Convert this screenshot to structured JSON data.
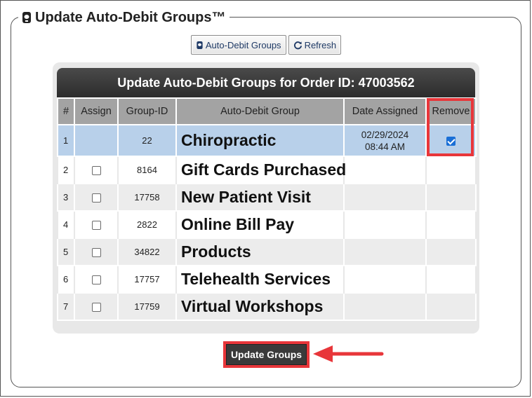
{
  "legend": {
    "title": "Update Auto-Debit Groups™",
    "icon": "piggy-bank-icon"
  },
  "toolbar": {
    "groups_button": "Auto-Debit Groups",
    "refresh_button": "Refresh"
  },
  "table": {
    "title": "Update Auto-Debit Groups for Order ID: 47003562",
    "headers": {
      "num": "#",
      "assign": "Assign",
      "group_id": "Group-ID",
      "group": "Auto-Debit Group",
      "date": "Date Assigned",
      "remove": "Remove"
    },
    "rows": [
      {
        "num": "1",
        "group_id": "22",
        "group": "Chiropractic",
        "date": "02/29/2024",
        "time": "08:44 AM",
        "assigned": true,
        "remove_checked": true
      },
      {
        "num": "2",
        "group_id": "8164",
        "group": "Gift Cards Purchased",
        "assigned": false
      },
      {
        "num": "3",
        "group_id": "17758",
        "group": "New Patient Visit",
        "assigned": false
      },
      {
        "num": "4",
        "group_id": "2822",
        "group": "Online Bill Pay",
        "assigned": false
      },
      {
        "num": "5",
        "group_id": "34822",
        "group": "Products",
        "assigned": false
      },
      {
        "num": "6",
        "group_id": "17757",
        "group": "Telehealth Services",
        "assigned": false
      },
      {
        "num": "7",
        "group_id": "17759",
        "group": "Virtual Workshops",
        "assigned": false
      }
    ]
  },
  "update_button": "Update Groups",
  "colors": {
    "highlight": "#e8363a",
    "selected_row": "#b8d0ea",
    "header_bar": "#2c2c2c"
  }
}
